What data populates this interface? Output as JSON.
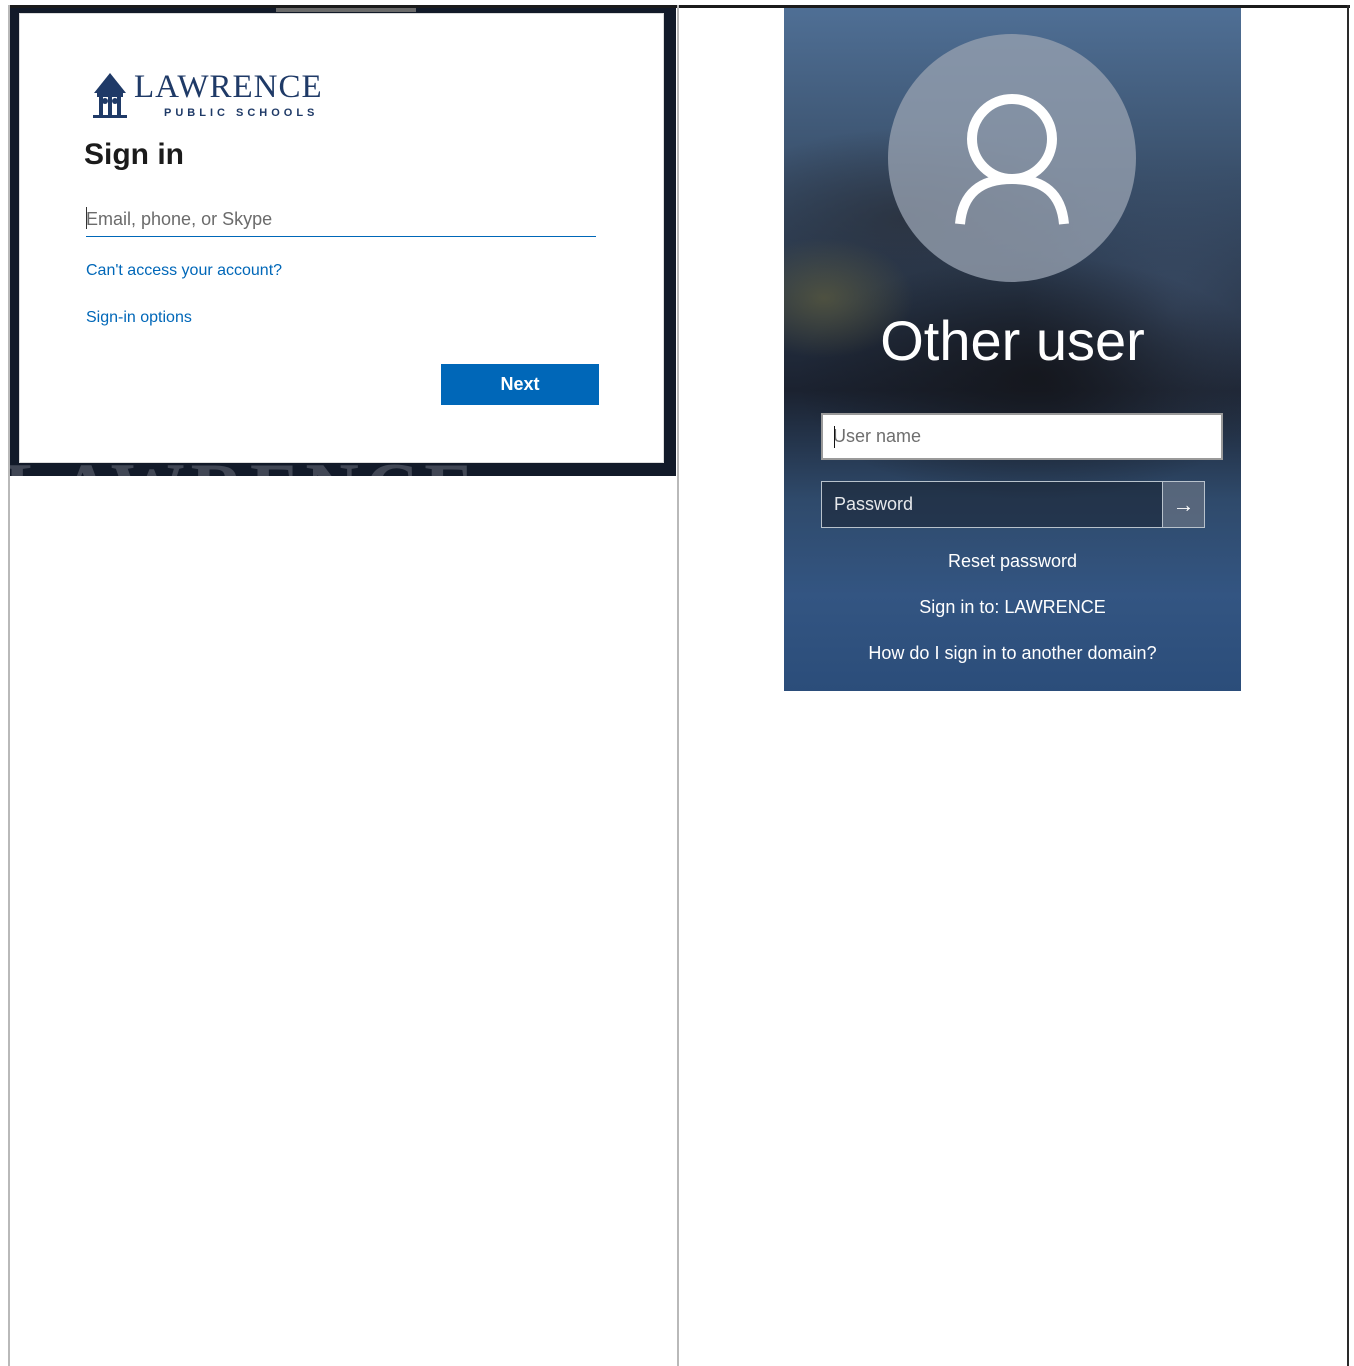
{
  "left_panel": {
    "logo": {
      "word": "LAWRENCE",
      "sub": "PUBLIC SCHOOLS"
    },
    "background_watermark": "LAWRENCE",
    "title": "Sign in",
    "email_placeholder": "Email, phone, or Skype",
    "links": {
      "cant_access": "Can't access your account?",
      "signin_options": "Sign-in options"
    },
    "next_label": "Next",
    "colors": {
      "accent": "#0067b8",
      "brand": "#1f3a67"
    }
  },
  "right_panel": {
    "title": "Other user",
    "username_placeholder": "User name",
    "password_placeholder": "Password",
    "submit_icon": "arrow-right-icon",
    "links": {
      "reset_password": "Reset password",
      "sign_in_to": "Sign in to: LAWRENCE",
      "another_domain": "How do I sign in to another domain?"
    }
  }
}
